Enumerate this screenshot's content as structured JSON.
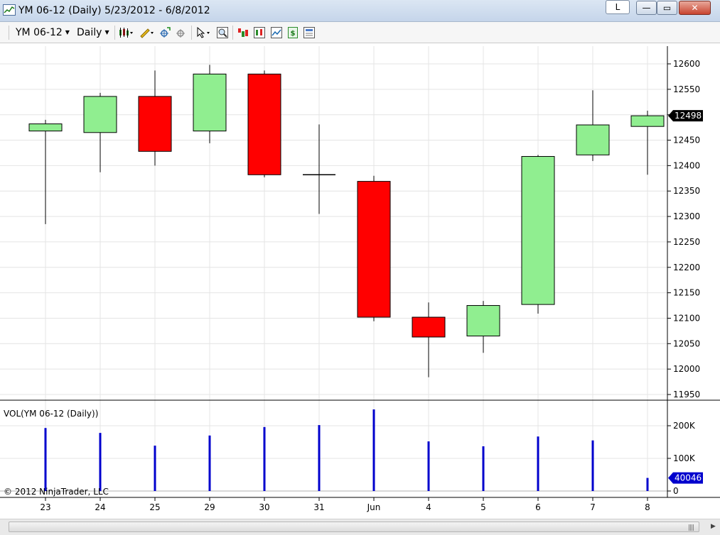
{
  "window": {
    "title": "YM 06-12 (Daily)  5/23/2012 - 6/8/2012",
    "link_button": "L",
    "min_glyph": "—",
    "max_glyph": "▭",
    "close_glyph": "✕"
  },
  "toolbar": {
    "instrument": "YM 06-12",
    "interval": "Daily",
    "icons": [
      "bar-style-icon",
      "drawing-pencil-icon",
      "crosshair-icon",
      "global-crosshair-icon",
      "cursor-icon",
      "zoom-icon",
      "strategy-icon",
      "indicators-icon",
      "chart-properties-icon",
      "data-box-icon",
      "chart-trader-icon"
    ]
  },
  "colors": {
    "up": "#90ee90",
    "down": "#ff0000",
    "volume": "#0000cd",
    "price_marker": "#000000",
    "volume_marker": "#0000cd",
    "grid": "#e4e4e4"
  },
  "chart_data": {
    "type": "candlestick",
    "title": "",
    "price_axis": {
      "ticks": [
        11950,
        12000,
        12050,
        12100,
        12150,
        12200,
        12250,
        12300,
        12350,
        12400,
        12450,
        12500,
        12550,
        12600
      ],
      "range": [
        11935,
        12625
      ],
      "last_value": "12498"
    },
    "x_labels": [
      "23",
      "24",
      "25",
      "29",
      "30",
      "31",
      "Jun",
      "4",
      "5",
      "6",
      "7",
      "8"
    ],
    "candles": [
      {
        "date": "5/23",
        "open": 12468,
        "high": 12490,
        "low": 12285,
        "close": 12482
      },
      {
        "date": "5/24",
        "open": 12465,
        "high": 12543,
        "low": 12387,
        "close": 12536
      },
      {
        "date": "5/25",
        "open": 12536,
        "high": 12587,
        "low": 12400,
        "close": 12428
      },
      {
        "date": "5/29",
        "open": 12468,
        "high": 12598,
        "low": 12444,
        "close": 12580
      },
      {
        "date": "5/30",
        "open": 12580,
        "high": 12587,
        "low": 12377,
        "close": 12382
      },
      {
        "date": "5/31",
        "open": 12382,
        "high": 12481,
        "low": 12305,
        "close": 12382
      },
      {
        "date": "6/1",
        "open": 12369,
        "high": 12380,
        "low": 12094,
        "close": 12102
      },
      {
        "date": "6/4",
        "open": 12102,
        "high": 12131,
        "low": 11984,
        "close": 12063
      },
      {
        "date": "6/5",
        "open": 12065,
        "high": 12134,
        "low": 12032,
        "close": 12125
      },
      {
        "date": "6/6",
        "open": 12127,
        "high": 12421,
        "low": 12109,
        "close": 12418
      },
      {
        "date": "6/7",
        "open": 12421,
        "high": 12548,
        "low": 12409,
        "close": 12480
      },
      {
        "date": "6/8",
        "open": 12477,
        "high": 12508,
        "low": 12382,
        "close": 12498
      }
    ],
    "volume": {
      "label": "VOL(YM 06-12 (Daily))",
      "ticks": [
        {
          "value": 0,
          "label": "0"
        },
        {
          "value": 100000,
          "label": "100K"
        },
        {
          "value": 200000,
          "label": "200K"
        }
      ],
      "values": [
        193000,
        178000,
        139000,
        170000,
        196000,
        202000,
        250000,
        152000,
        137000,
        167000,
        155000,
        40046
      ],
      "last_value": "40046"
    }
  },
  "footer": {
    "copyright": "© 2012 NinjaTrader, LLC"
  }
}
